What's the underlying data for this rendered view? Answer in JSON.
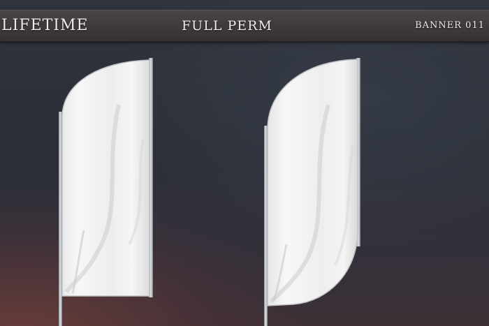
{
  "header": {
    "left_text": "LIFETIME",
    "center_text": "FULL PERM",
    "right_text": "BANNER 011"
  },
  "colors": {
    "background": "#2d3038",
    "header_bar": "#403b3e",
    "header_text": "#efe8e4",
    "flag_fabric": "#f2f2f2",
    "pole": "#c9ccd1"
  },
  "flags": [
    {
      "name": "feather-flag",
      "shape": "feather"
    },
    {
      "name": "teardrop-flag",
      "shape": "rounded-both-ends"
    }
  ]
}
